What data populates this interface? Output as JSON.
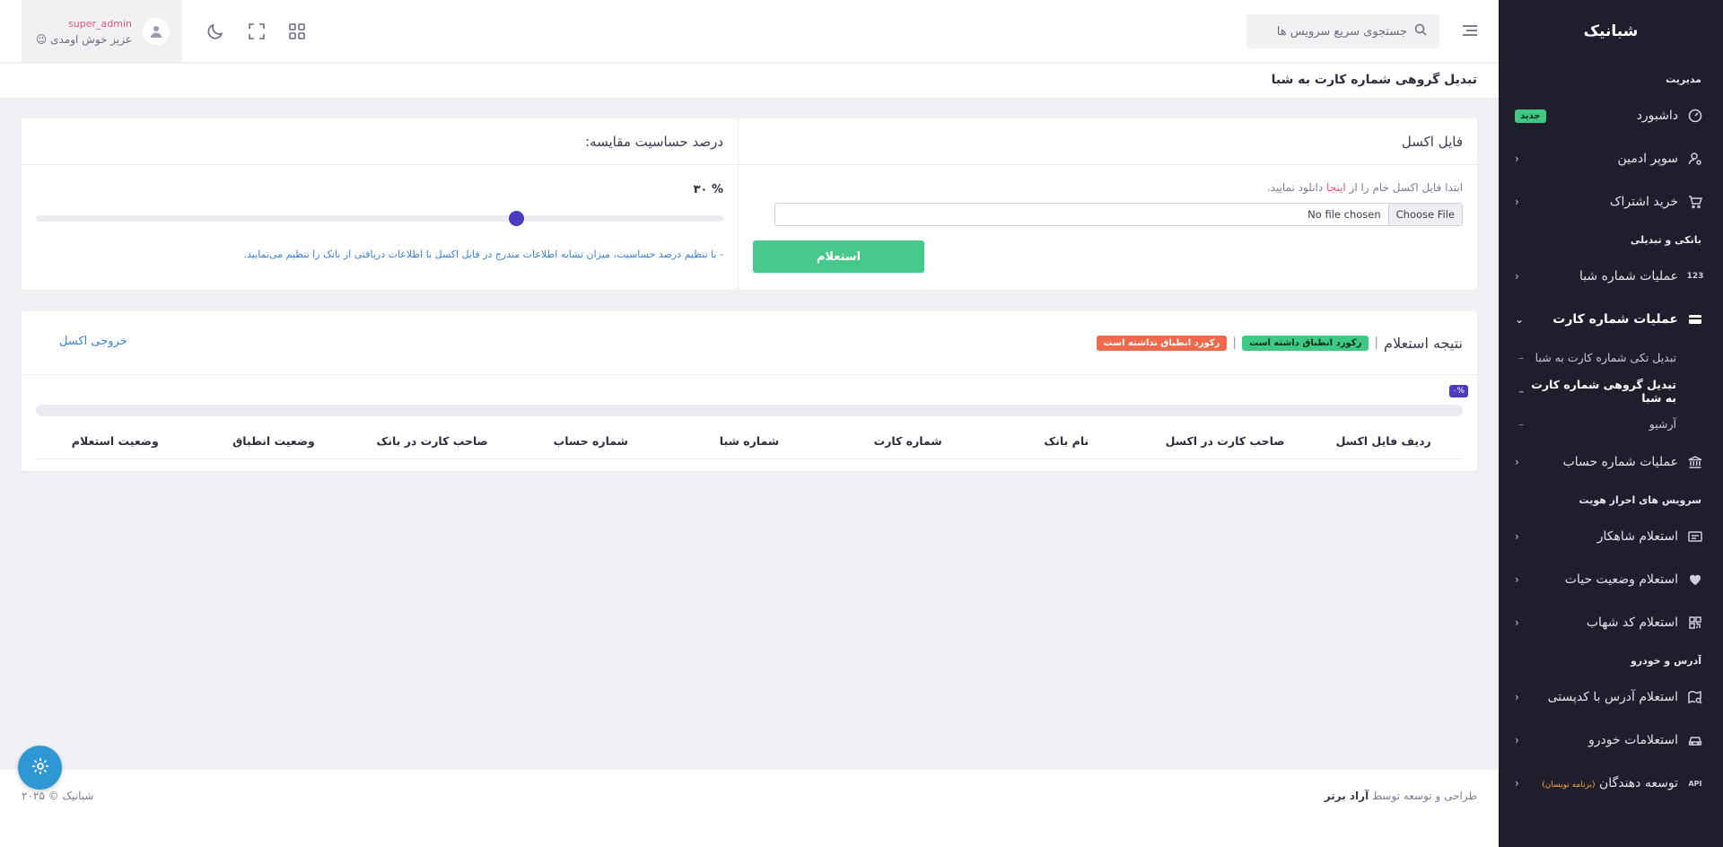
{
  "sidebar": {
    "brand": "شبانیک",
    "sections": {
      "management": "مدیریت",
      "banking": "بانکی و تبدیلی",
      "identity": "سرویس های احراز هویت",
      "address": "آدرس و خودرو"
    },
    "items": {
      "dashboard": "داشبورد",
      "dashboard_badge": "جدید",
      "super_admin": "سوپر ادمین",
      "buy_subscription": "خرید اشتراک",
      "sheba_ops": "عملیات شماره شبا",
      "card_ops": "عملیات شماره کارت",
      "card_sub_single": "تبدیل تکی شماره کارت به شبا",
      "card_sub_bulk": "تبدیل گروهی شماره کارت به شبا",
      "card_sub_archive": "آرشیو",
      "account_ops": "عملیات شماره حساب",
      "shahkar": "استعلام شاهکار",
      "life_status": "استعلام وضعیت حیات",
      "shahab": "استعلام کد شهاب",
      "postal_address": "استعلام آدرس با کدپستی",
      "vehicle": "استعلامات خودرو",
      "developers": "توسعه دهندگان",
      "developers_note": "(برنامه نویسان)",
      "sheba_icon_text": "123",
      "api_icon_text": "API"
    }
  },
  "header": {
    "search_placeholder": "جستجوی سریع سرویس ها",
    "user_name": "super_admin",
    "user_greeting": "عزیز خوش اومدی",
    "greeting_emoji": "😉"
  },
  "page": {
    "title": "تبدیل گروهی شماره کارت به شبا"
  },
  "excel_card": {
    "title": "فایل اکسل",
    "helper_before": "ابتدا فایل اکسل خام را از",
    "helper_link": "اینجا",
    "helper_after": "دانلود نمایید.",
    "file_button": "Choose File",
    "file_status": "No file chosen",
    "submit": "استعلام"
  },
  "sensitivity_card": {
    "title": "درصد حساسیت مقایسه:",
    "value_label": "% ۳۰",
    "value": 30,
    "note": "- با تنظیم درصد حساسیت، میزان تشابه اطلاعات مندرج در فایل اکسل با اطلاعات دریافتی از بانک را تنظیم می‌نمایید."
  },
  "result_card": {
    "title": "نتیجه استعلام",
    "separator": "|",
    "legend_match": "رکورد انطباق داشته است",
    "legend_nomatch": "رکورد انطباق نداشته است",
    "export": "خروجی اکسل",
    "progress_label": "۰%",
    "progress": 0,
    "columns": [
      "ردیف فایل اکسل",
      "صاحب کارت در اکسل",
      "نام بانک",
      "شماره کارت",
      "شماره شبا",
      "شماره حساب",
      "صاحب کارت در بانک",
      "وضعیت انطباق",
      "وضعیت استعلام"
    ]
  },
  "footer": {
    "designed_by": "طراحی و توسعه توسط",
    "company": "آراد برتر",
    "copyright": "شبانیک © ۲۰۲۵"
  },
  "colors": {
    "sidebar_bg": "#1e1e2d",
    "accent_purple": "#4a3bbf",
    "success_green": "#47c98b",
    "danger_red": "#ef6a4d",
    "link_blue": "#3b82d6",
    "pink": "#e4567a",
    "fab_blue": "#2f97d3"
  }
}
